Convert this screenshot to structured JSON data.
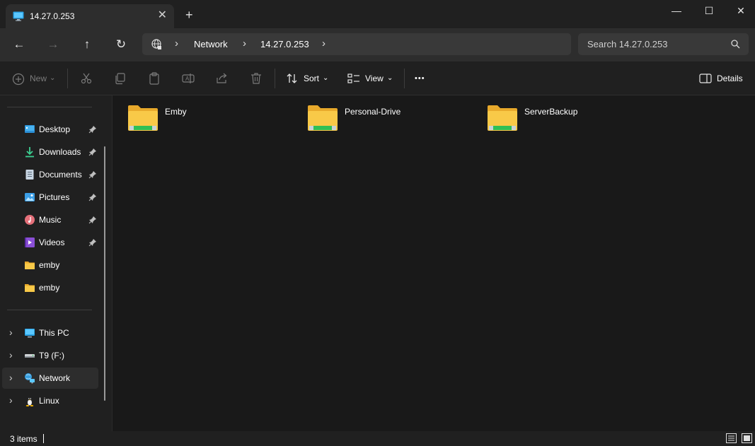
{
  "window": {
    "tab_title": "14.27.0.253",
    "tab_close": "✕",
    "new_tab": "+",
    "minimize": "—",
    "maximize": "☐",
    "close": "✕"
  },
  "nav": {
    "back": "←",
    "forward": "→",
    "up": "↑",
    "refresh": "↻",
    "breadcrumb": [
      "Network",
      "14.27.0.253"
    ],
    "separator": "›",
    "search_placeholder": "Search 14.27.0.253"
  },
  "commands": {
    "new": "New",
    "sort": "Sort",
    "view": "View",
    "more": "•••",
    "details": "Details",
    "dropdown_caret": "⌄"
  },
  "sidebar": {
    "quick_access": [
      {
        "label": "Desktop",
        "icon": "desktop-icon",
        "pinned": true
      },
      {
        "label": "Downloads",
        "icon": "download-icon",
        "pinned": true
      },
      {
        "label": "Documents",
        "icon": "document-icon",
        "pinned": true
      },
      {
        "label": "Pictures",
        "icon": "pictures-icon",
        "pinned": true
      },
      {
        "label": "Music",
        "icon": "music-icon",
        "pinned": true
      },
      {
        "label": "Videos",
        "icon": "videos-icon",
        "pinned": true
      },
      {
        "label": "emby",
        "icon": "folder-icon",
        "pinned": false
      },
      {
        "label": "emby",
        "icon": "folder-icon",
        "pinned": false
      }
    ],
    "locations": [
      {
        "label": "This PC",
        "icon": "pc-icon",
        "selected": false
      },
      {
        "label": "T9 (F:)",
        "icon": "drive-icon",
        "selected": false
      },
      {
        "label": "Network",
        "icon": "network-icon",
        "selected": true
      },
      {
        "label": "Linux",
        "icon": "linux-icon",
        "selected": false
      }
    ],
    "chevron": "›"
  },
  "content": {
    "items": [
      {
        "name": "Emby",
        "icon": "network-share-folder-icon"
      },
      {
        "name": "Personal-Drive",
        "icon": "network-share-folder-icon"
      },
      {
        "name": "ServerBackup",
        "icon": "network-share-folder-icon"
      }
    ]
  },
  "status": {
    "item_count": "3 items"
  },
  "colors": {
    "background": "#202020",
    "content_background": "#191919",
    "navbar": "#2d2d2d",
    "folder_yellow": "#f8c948",
    "share_green": "#2fbf55"
  }
}
